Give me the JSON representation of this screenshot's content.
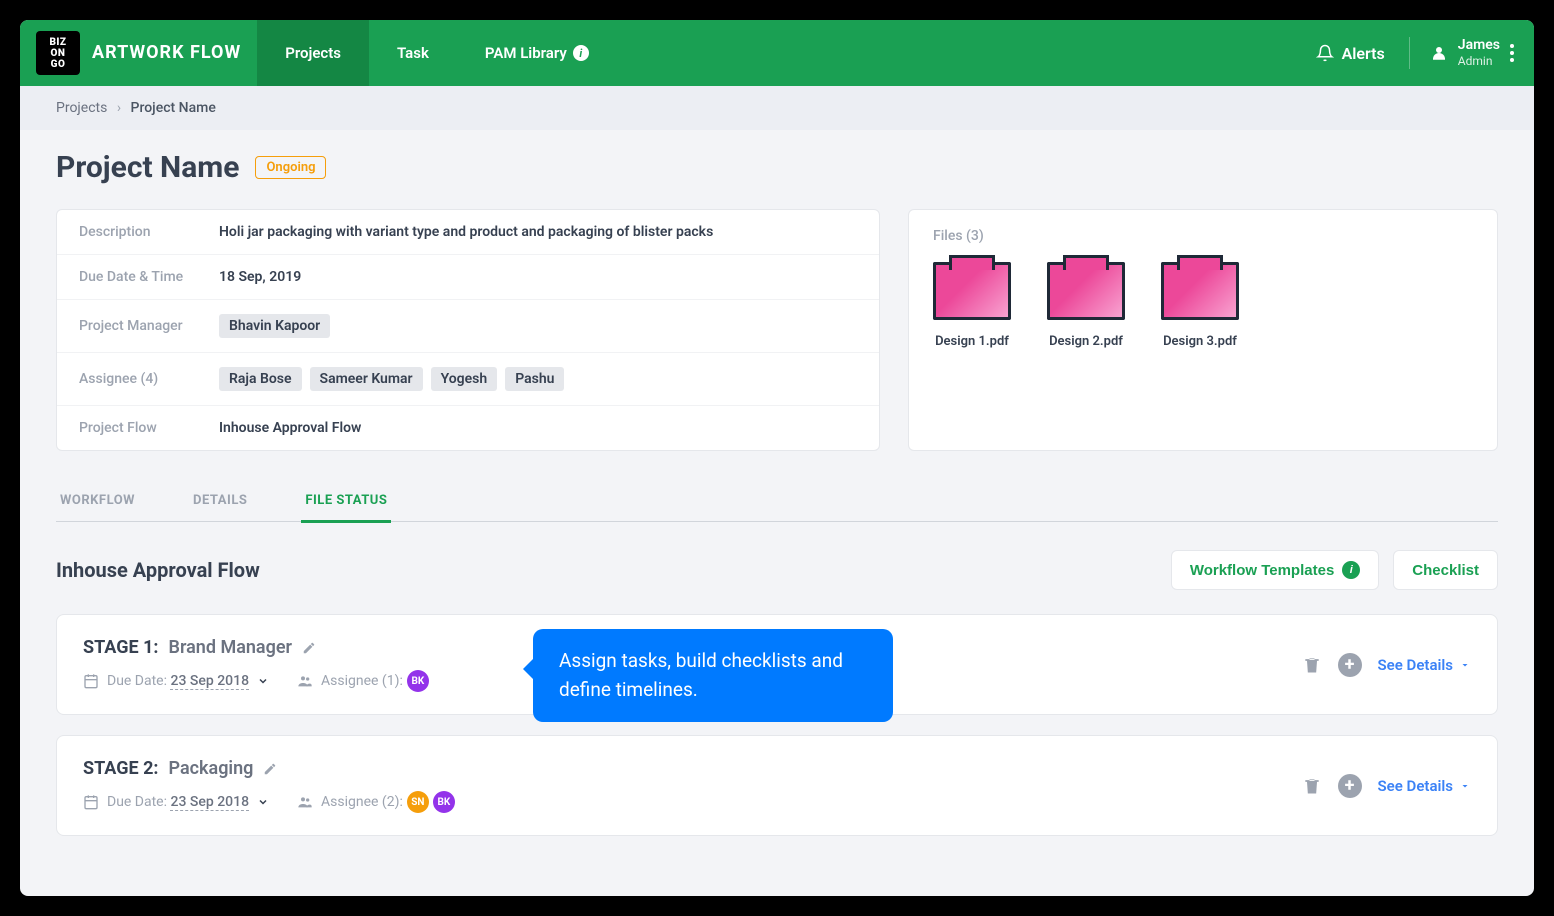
{
  "header": {
    "logo_text": [
      "BIZ",
      "ON",
      "GO"
    ],
    "app_name": "ARTWORK FLOW",
    "nav": [
      {
        "label": "Projects",
        "active": true
      },
      {
        "label": "Task",
        "active": false
      },
      {
        "label": "PAM Library",
        "active": false,
        "info": true
      }
    ],
    "alerts_label": "Alerts",
    "user": {
      "name": "James",
      "role": "Admin"
    }
  },
  "breadcrumb": {
    "root": "Projects",
    "current": "Project Name"
  },
  "project": {
    "title": "Project Name",
    "status": "Ongoing",
    "details": {
      "description_label": "Description",
      "description": "Holi jar packaging with variant type and product and packaging of blister packs",
      "due_label": "Due Date & Time",
      "due_value": "18 Sep, 2019",
      "pm_label": "Project Manager",
      "pm_value": "Bhavin Kapoor",
      "assignee_label": "Assignee (4)",
      "assignees": [
        "Raja Bose",
        "Sameer Kumar",
        "Yogesh",
        "Pashu"
      ],
      "flow_label": "Project Flow",
      "flow_value": "Inhouse Approval Flow"
    },
    "files": {
      "label": "Files (3)",
      "items": [
        "Design 1.pdf",
        "Design 2.pdf",
        "Design 3.pdf"
      ]
    }
  },
  "tabs": [
    {
      "label": "WORKFLOW",
      "active": false
    },
    {
      "label": "DETAILS",
      "active": false
    },
    {
      "label": "FILE STATUS",
      "active": true
    }
  ],
  "flow": {
    "title": "Inhouse Approval Flow",
    "template_btn": "Workflow Templates",
    "checklist_btn": "Checklist",
    "stages": [
      {
        "num": "STAGE 1:",
        "name": "Brand Manager",
        "due_label": "Due Date:",
        "due_value": "23 Sep 2018",
        "assignee_label": "Assignee (1):",
        "avatars": [
          {
            "initials": "BK",
            "cls": "av-purple"
          }
        ],
        "see_details": "See Details"
      },
      {
        "num": "STAGE 2:",
        "name": "Packaging",
        "due_label": "Due Date:",
        "due_value": "23 Sep 2018",
        "assignee_label": "Assignee (2):",
        "avatars": [
          {
            "initials": "SN",
            "cls": "av-orange"
          },
          {
            "initials": "BK",
            "cls": "av-purple"
          }
        ],
        "see_details": "See Details"
      }
    ]
  },
  "tooltip": "Assign tasks, build checklists and define timelines."
}
